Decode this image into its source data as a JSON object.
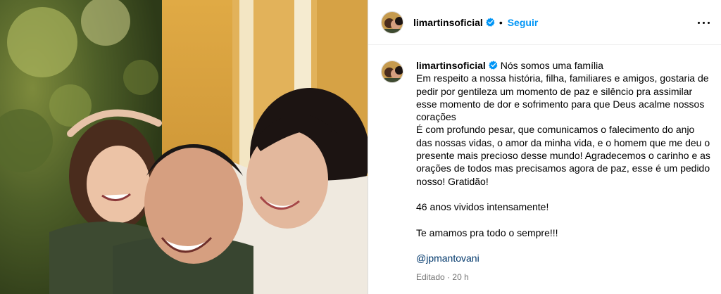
{
  "post": {
    "username": "limartinsoficial",
    "follow_label": "Seguir",
    "separator": "•",
    "more_label": "Mais opções"
  },
  "caption": {
    "username": "limartinsoficial",
    "lines": [
      "Nós somos uma família",
      "Em respeito a nossa história, filha, familiares e amigos, gostaria de",
      "pedir por gentileza um momento de paz e silêncio pra assimilar",
      "esse momento de dor e sofrimento para que Deus acalme nossos",
      "corações",
      "É com profundo pesar, que comunicamos o falecimento do anjo",
      "das nossas vidas, o amor da minha vida, e o homem que me deu o",
      "presente mais precioso desse mundo! Agradecemos o carinho e as",
      "orações de todos mas precisamos agora de paz, esse é um pedido",
      "nosso! Gratidão!",
      "",
      "46 anos vividos intensamente!",
      "",
      "Te amamos pra todo o sempre!!!",
      "",
      "@jpmantovani"
    ],
    "mention": "@jpmantovani",
    "edited_label": "Editado",
    "meta_separator": "·",
    "time": "20 h"
  },
  "colors": {
    "accent": "#0095f6",
    "verified": "#0095f6",
    "mention": "#00376b",
    "muted": "#737373"
  },
  "icons": [
    "verified-badge-icon",
    "more-options-icon"
  ]
}
